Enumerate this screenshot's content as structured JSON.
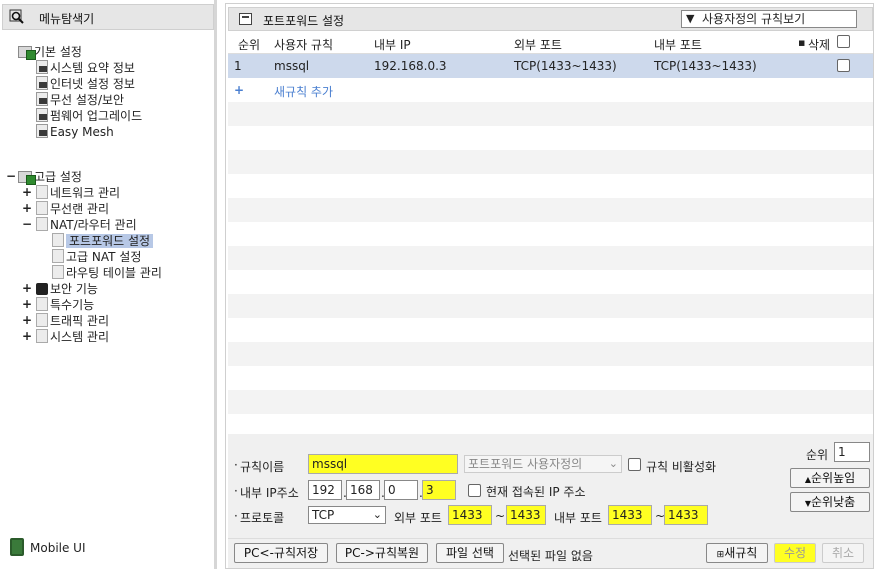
{
  "explorer": {
    "title": "메뉴탐색기",
    "basic": {
      "label": "기본 설정",
      "items": [
        "시스템 요약 정보",
        "인터넷 설정 정보",
        "무선 설정/보안",
        "펌웨어 업그레이드",
        "Easy Mesh"
      ]
    },
    "advanced": {
      "label": "고급 설정",
      "network": "네트워크 관리",
      "wireless": "무선랜 관리",
      "nat": "NAT/라우터 관리",
      "nat_items": [
        "포트포워드 설정",
        "고급 NAT 설정",
        "라우팅 테이블 관리"
      ],
      "security": "보안 기능",
      "special": "특수기능",
      "traffic": "트래픽 관리",
      "system": "시스템 관리"
    },
    "mobile_ui": "Mobile UI"
  },
  "panel": {
    "title": "포트포워드 설정",
    "view_select": "사용자정의 규칙보기"
  },
  "table": {
    "headers": {
      "order": "순위",
      "rule": "사용자 규칙",
      "internal_ip": "내부 IP",
      "external_port": "외부 포트",
      "internal_port": "내부 포트",
      "delete": "삭제"
    },
    "rows": [
      {
        "order": "1",
        "rule": "mssql",
        "internal_ip": "192.168.0.3",
        "external_port": "TCP(1433~1433)",
        "internal_port": "TCP(1433~1433)"
      }
    ],
    "add_rule": "새규칙 추가"
  },
  "form": {
    "rule_name_label": "규칙이름",
    "rule_name_value": "mssql",
    "template_select": "포트포워드 사용자정의",
    "disable_rule": "규칙 비활성화",
    "order_label": "순위",
    "order_value": "1",
    "order_up": "순위높임",
    "order_down": "순위낮춤",
    "ip_label": "내부 IP주소",
    "ip": [
      "192",
      "168",
      "0",
      "3"
    ],
    "current_ip": "현재 접속된 IP 주소",
    "protocol_label": "프로토콜",
    "protocol_value": "TCP",
    "ext_port_label": "외부 포트",
    "ext_port_from": "1433",
    "ext_port_to": "1433",
    "int_port_label": "내부 포트",
    "int_port_from": "1433",
    "int_port_to": "1433",
    "tilde": "~"
  },
  "bottom": {
    "save_to_pc": "PC<-규칙저장",
    "restore_from_pc": "PC->규칙복원",
    "choose_file": "파일 선택",
    "no_file": "선택된 파일 없음",
    "new_rule": "새규칙",
    "modify": "수정",
    "cancel": "취소"
  },
  "colors": {
    "highlight_yellow": "#ffff22",
    "selected_row": "#cdd9ec",
    "link_blue": "#4a7fd0"
  }
}
